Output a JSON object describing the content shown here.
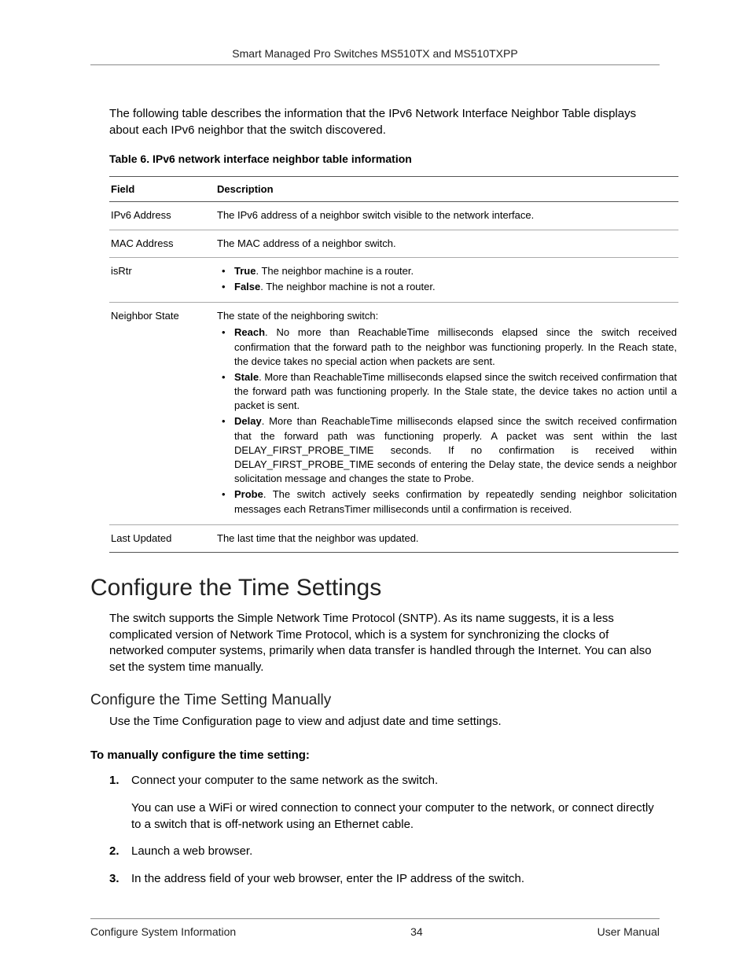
{
  "header": {
    "title": "Smart Managed Pro Switches MS510TX and MS510TXPP"
  },
  "intro": "The following table describes the information that the IPv6 Network Interface Neighbor Table displays about each IPv6 neighbor that the switch discovered.",
  "table": {
    "caption": "Table 6.  IPv6 network interface neighbor table information",
    "head": {
      "field": "Field",
      "desc": "Description"
    },
    "rows": {
      "r0": {
        "field": "IPv6 Address",
        "desc": "The IPv6 address of a neighbor switch visible to the network interface."
      },
      "r1": {
        "field": "MAC Address",
        "desc": "The MAC address of a neighbor switch."
      },
      "r2": {
        "field": "isRtr",
        "items": {
          "i0": {
            "b": "True",
            "t": ". The neighbor machine is a router."
          },
          "i1": {
            "b": "False",
            "t": ". The neighbor machine is not a router."
          }
        }
      },
      "r3": {
        "field": "Neighbor State",
        "intro": "The state of the neighboring switch:",
        "items": {
          "i0": {
            "b": "Reach",
            "t": ". No more than ReachableTime milliseconds elapsed since the switch received confirmation that the forward path to the neighbor was functioning properly. In the Reach state, the device takes no special action when packets are sent."
          },
          "i1": {
            "b": "Stale",
            "t": ". More than ReachableTime milliseconds elapsed since the switch received confirmation that the forward path was functioning properly. In the Stale state, the device takes no action until a packet is sent."
          },
          "i2": {
            "b": "Delay",
            "t": ". More than ReachableTime milliseconds elapsed since the switch received confirmation that the forward path was functioning properly. A packet was sent within the last DELAY_FIRST_PROBE_TIME seconds. If no confirmation is received within DELAY_FIRST_PROBE_TIME seconds of entering the Delay state, the device sends a neighbor solicitation message and changes the state to Probe."
          },
          "i3": {
            "b": "Probe",
            "t": ". The switch actively seeks confirmation by repeatedly sending neighbor solicitation messages each RetransTimer milliseconds until a confirmation is received."
          }
        }
      },
      "r4": {
        "field": "Last Updated",
        "desc": "The last time that the neighbor was updated."
      }
    }
  },
  "section": {
    "h1": "Configure the Time Settings",
    "p1": "The switch supports the Simple Network Time Protocol (SNTP). As its name suggests, it is a less complicated version of Network Time Protocol, which is a system for synchronizing the clocks of networked computer systems, primarily when data transfer is handled through the Internet. You can also set the system time manually.",
    "h2": "Configure the Time Setting Manually",
    "p2": "Use the Time Configuration page to view and adjust date and time settings.",
    "lead": "To manually configure the time setting:",
    "steps": {
      "s1": "Connect your computer to the same network as the switch.",
      "s1note": "You can use a WiFi or wired connection to connect your computer to the network, or connect directly to a switch that is off-network using an Ethernet cable.",
      "s2": "Launch a web browser.",
      "s3": "In the address field of your web browser, enter the IP address of the switch."
    }
  },
  "footer": {
    "left": "Configure System Information",
    "center": "34",
    "right": "User Manual"
  }
}
